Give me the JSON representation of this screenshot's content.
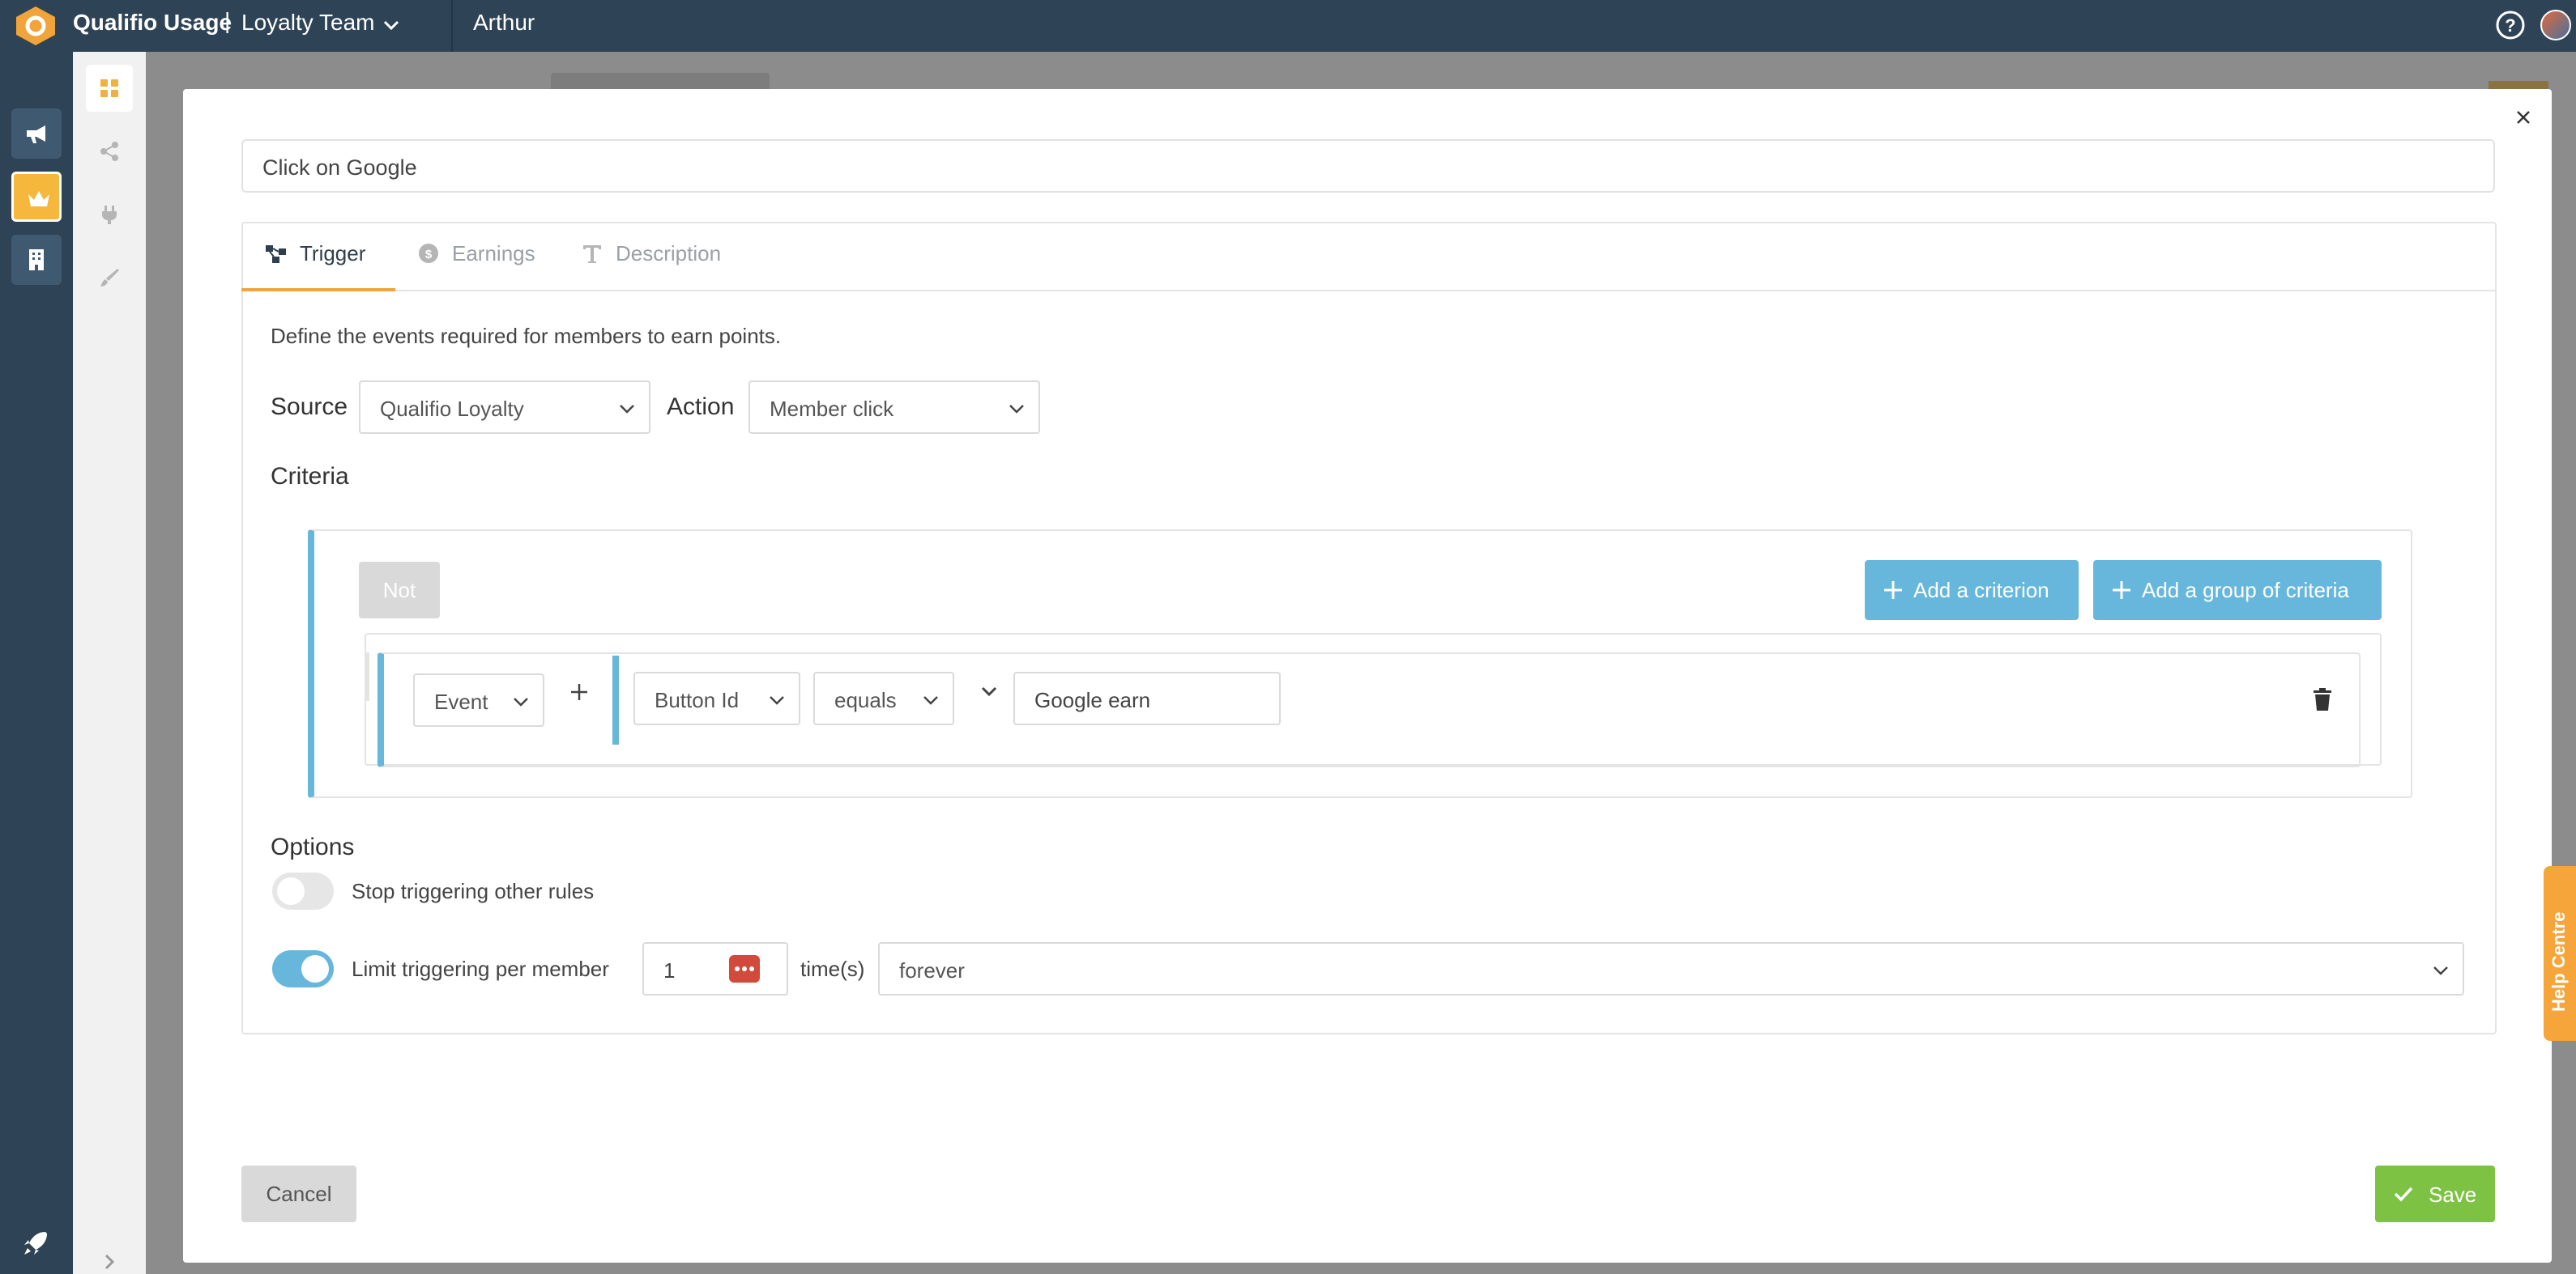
{
  "topbar": {
    "app_name": "Qualifio Usage",
    "separator": "|",
    "team": "Loyalty Team",
    "user": "Arthur"
  },
  "rail": {
    "items": [
      {
        "icon": "megaphone-icon"
      },
      {
        "icon": "crown-icon"
      },
      {
        "icon": "building-icon"
      }
    ],
    "bottom_icon": "rocket-icon"
  },
  "sidebar": {
    "items": [
      {
        "icon": "grid-icon"
      },
      {
        "icon": "share-icon"
      },
      {
        "icon": "plug-icon"
      },
      {
        "icon": "brush-icon"
      }
    ]
  },
  "modal": {
    "name_value": "Click on Google",
    "tabs": [
      {
        "label": "Trigger",
        "icon": "flow-icon",
        "active": true
      },
      {
        "label": "Earnings",
        "icon": "coin-icon",
        "active": false
      },
      {
        "label": "Description",
        "icon": "text-icon",
        "active": false
      }
    ],
    "intro": "Define the events required for members to earn points.",
    "source_label": "Source",
    "source_value": "Qualifio Loyalty",
    "action_label": "Action",
    "action_value": "Member click",
    "criteria_label": "Criteria",
    "not_label": "Not",
    "add_criterion": "Add a criterion",
    "add_group": "Add a group of criteria",
    "event_select": "Event",
    "field_select": "Button Id",
    "operator_select": "equals",
    "criterion_value": "Google earn",
    "options_label": "Options",
    "stop_triggering": "Stop triggering other rules",
    "stop_triggering_on": false,
    "limit_triggering": "Limit triggering per member",
    "limit_triggering_on": true,
    "limit_count": "1",
    "times_label": "time(s)",
    "period_value": "forever",
    "cancel": "Cancel",
    "save": "Save"
  },
  "help_centre": "Help Centre",
  "colors": {
    "topbar": "#2e4456",
    "accent_orange": "#f0a43a",
    "accent_blue": "#67b7dc",
    "save_green": "#7dc243"
  }
}
